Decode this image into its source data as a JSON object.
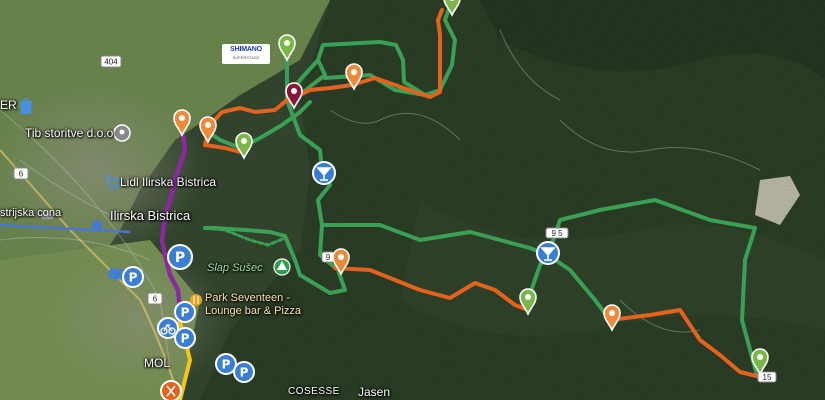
{
  "sponsor_logo": {
    "brand": "SHIMANO",
    "tagline": "SUPERSTAGE"
  },
  "places": [
    {
      "id": "town",
      "text": "Ilirska Bistrica"
    },
    {
      "id": "shop-tib",
      "text": "Tib storitve d.o.o"
    },
    {
      "id": "lidl",
      "text": "Lidl Ilirska Bistrica"
    },
    {
      "id": "zone",
      "text": "strijska cona"
    },
    {
      "id": "cut-er",
      "text": "ER"
    },
    {
      "id": "slap",
      "text": "Slap Sušec"
    },
    {
      "id": "park-1",
      "text": "Park Seventeen -"
    },
    {
      "id": "park-2",
      "text": "Lounge bar & Pizza"
    },
    {
      "id": "mol",
      "text": "MOL"
    },
    {
      "id": "cosesse",
      "text": "COSESSE"
    },
    {
      "id": "jasen",
      "text": "Jasen"
    }
  ],
  "road_badges": [
    "404",
    "6",
    "6",
    "9",
    "9 5",
    "15"
  ],
  "route_colors": {
    "green": "#3aa055",
    "orange": "#e4621e",
    "purple": "#8b2aa0",
    "yellow": "#f5c518"
  },
  "markers": [
    {
      "name": "green-marker-top",
      "color": "#7ab648"
    },
    {
      "name": "green-marker-logo",
      "color": "#7ab648"
    },
    {
      "name": "maroon-marker",
      "color": "#8a1538"
    },
    {
      "name": "orange-marker-north",
      "color": "#ec8a3c"
    },
    {
      "name": "orange-marker-west-1",
      "color": "#ec8a3c"
    },
    {
      "name": "orange-marker-west-2",
      "color": "#ec8a3c"
    },
    {
      "name": "green-marker-west",
      "color": "#7ab648"
    },
    {
      "name": "orange-marker-center",
      "color": "#ec8a3c"
    },
    {
      "name": "green-marker-center",
      "color": "#7ab648"
    },
    {
      "name": "orange-marker-east",
      "color": "#ec8a3c"
    },
    {
      "name": "green-marker-east",
      "color": "#7ab648"
    }
  ],
  "poi_icons": [
    "cocktail-icon",
    "cocktail-icon",
    "parking-icon",
    "bicycle-icon",
    "restaurant-icon",
    "location-pin-icon",
    "shopping-cart-icon",
    "shopping-bag-icon",
    "camera-icon",
    "tree-icon"
  ]
}
